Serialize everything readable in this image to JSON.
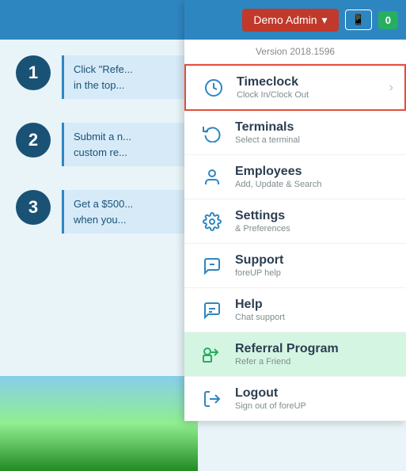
{
  "topbar": {
    "admin_label": "Demo Admin",
    "dropdown_arrow": "▾",
    "phone_icon": "📱",
    "badge_count": "0",
    "version": "Version 2018.1596"
  },
  "menu_items": [
    {
      "id": "timeclock",
      "title": "Timeclock",
      "subtitle": "Clock In/Clock Out",
      "icon": "clock",
      "highlighted": true
    },
    {
      "id": "terminals",
      "title": "Terminals",
      "subtitle": "Select a terminal",
      "icon": "refresh",
      "highlighted": false
    },
    {
      "id": "employees",
      "title": "Employees",
      "subtitle": "Add, Update & Search",
      "icon": "person",
      "highlighted": false
    },
    {
      "id": "settings",
      "title": "Settings",
      "subtitle": "& Preferences",
      "icon": "gear",
      "highlighted": false
    },
    {
      "id": "support",
      "title": "Support",
      "subtitle": "foreUP help",
      "icon": "chat",
      "highlighted": false
    },
    {
      "id": "help",
      "title": "Help",
      "subtitle": "Chat support",
      "icon": "chat2",
      "highlighted": false
    },
    {
      "id": "referral",
      "title": "Referral Program",
      "subtitle": "Refer a Friend",
      "icon": "cart",
      "highlighted": false,
      "referral": true
    },
    {
      "id": "logout",
      "title": "Logout",
      "subtitle": "Sign out of foreUP",
      "icon": "signout",
      "highlighted": false
    }
  ],
  "steps": [
    {
      "number": "1",
      "text": "Click \"Refe...\nin the top..."
    },
    {
      "number": "2",
      "text": "Submit a n...\ncustom re..."
    },
    {
      "number": "3",
      "text": "Get a $500...\nwhen you..."
    }
  ],
  "colors": {
    "accent_blue": "#2e86c1",
    "dark_blue": "#1a5276",
    "red_highlight": "#e74c3c",
    "green_referral": "#d5f5e3",
    "admin_red": "#c0392b",
    "badge_green": "#27ae60"
  }
}
